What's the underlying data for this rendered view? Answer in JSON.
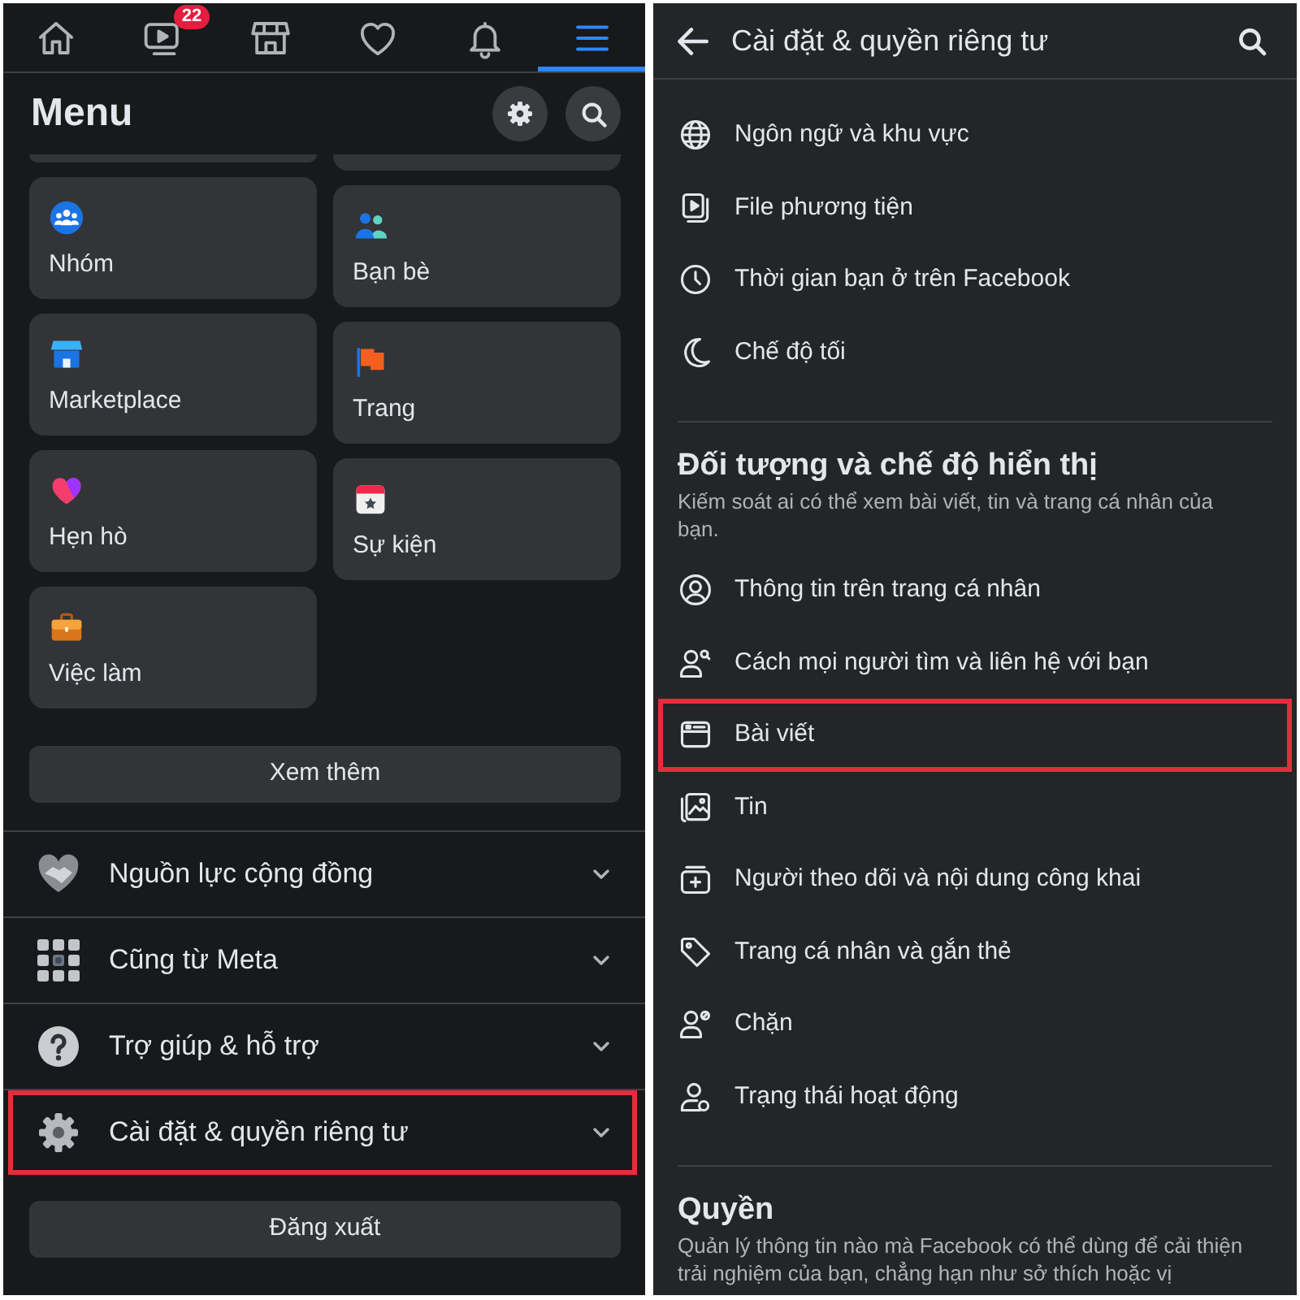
{
  "left_screen": {
    "tab_bar": {
      "tabs": [
        {
          "selected": false
        },
        {
          "selected": false,
          "badge": "22"
        },
        {
          "selected": false
        },
        {
          "selected": false
        },
        {
          "selected": false
        },
        {
          "selected": true
        }
      ]
    },
    "header": {
      "title": "Menu"
    },
    "shortcuts": [
      {
        "label": "Nhóm"
      },
      {
        "label": "Bạn bè"
      },
      {
        "label": "Marketplace"
      },
      {
        "label": "Trang"
      },
      {
        "label": "Hẹn hò"
      },
      {
        "label": "Sự kiện"
      },
      {
        "label": "Việc làm"
      }
    ],
    "see_more_button": "Xem thêm",
    "sections": [
      {
        "label": "Nguồn lực cộng đồng",
        "expanded": false,
        "highlighted": false
      },
      {
        "label": "Cũng từ Meta",
        "expanded": false,
        "highlighted": false
      },
      {
        "label": "Trợ giúp & hỗ trợ",
        "expanded": false,
        "highlighted": false
      },
      {
        "label": "Cài đặt & quyền riêng tư",
        "expanded": false,
        "highlighted": true
      }
    ],
    "logout_button": "Đăng xuất"
  },
  "right_screen": {
    "header": {
      "title": "Cài đặt & quyền riêng tư"
    },
    "groups": [
      {
        "items": [
          {
            "label": "Ngôn ngữ và khu vực",
            "highlighted": false
          },
          {
            "label": "File phương tiện",
            "highlighted": false
          },
          {
            "label": "Thời gian bạn ở trên Facebook",
            "highlighted": false
          },
          {
            "label": "Chế độ tối",
            "highlighted": false
          }
        ]
      },
      {
        "title": "Đối tượng và chế độ hiển thị",
        "description": "Kiếm soát ai có thể xem bài viết, tin và trang cá nhân của bạn.",
        "items": [
          {
            "label": "Thông tin trên trang cá nhân",
            "highlighted": false
          },
          {
            "label": "Cách mọi người tìm và liên hệ với bạn",
            "highlighted": false
          },
          {
            "label": "Bài viết",
            "highlighted": true
          },
          {
            "label": "Tin",
            "highlighted": false
          },
          {
            "label": "Người theo dõi và nội dung công khai",
            "highlighted": false
          },
          {
            "label": "Trang cá nhân và gắn thẻ",
            "highlighted": false
          },
          {
            "label": "Chặn",
            "highlighted": false
          },
          {
            "label": "Trạng thái hoạt động",
            "highlighted": false
          }
        ]
      },
      {
        "title": "Quyền",
        "description": "Quản lý thông tin nào mà Facebook có thể dùng để cải thiện trải nghiệm của bạn, chẳng hạn như sở thích hoặc vị"
      }
    ]
  }
}
